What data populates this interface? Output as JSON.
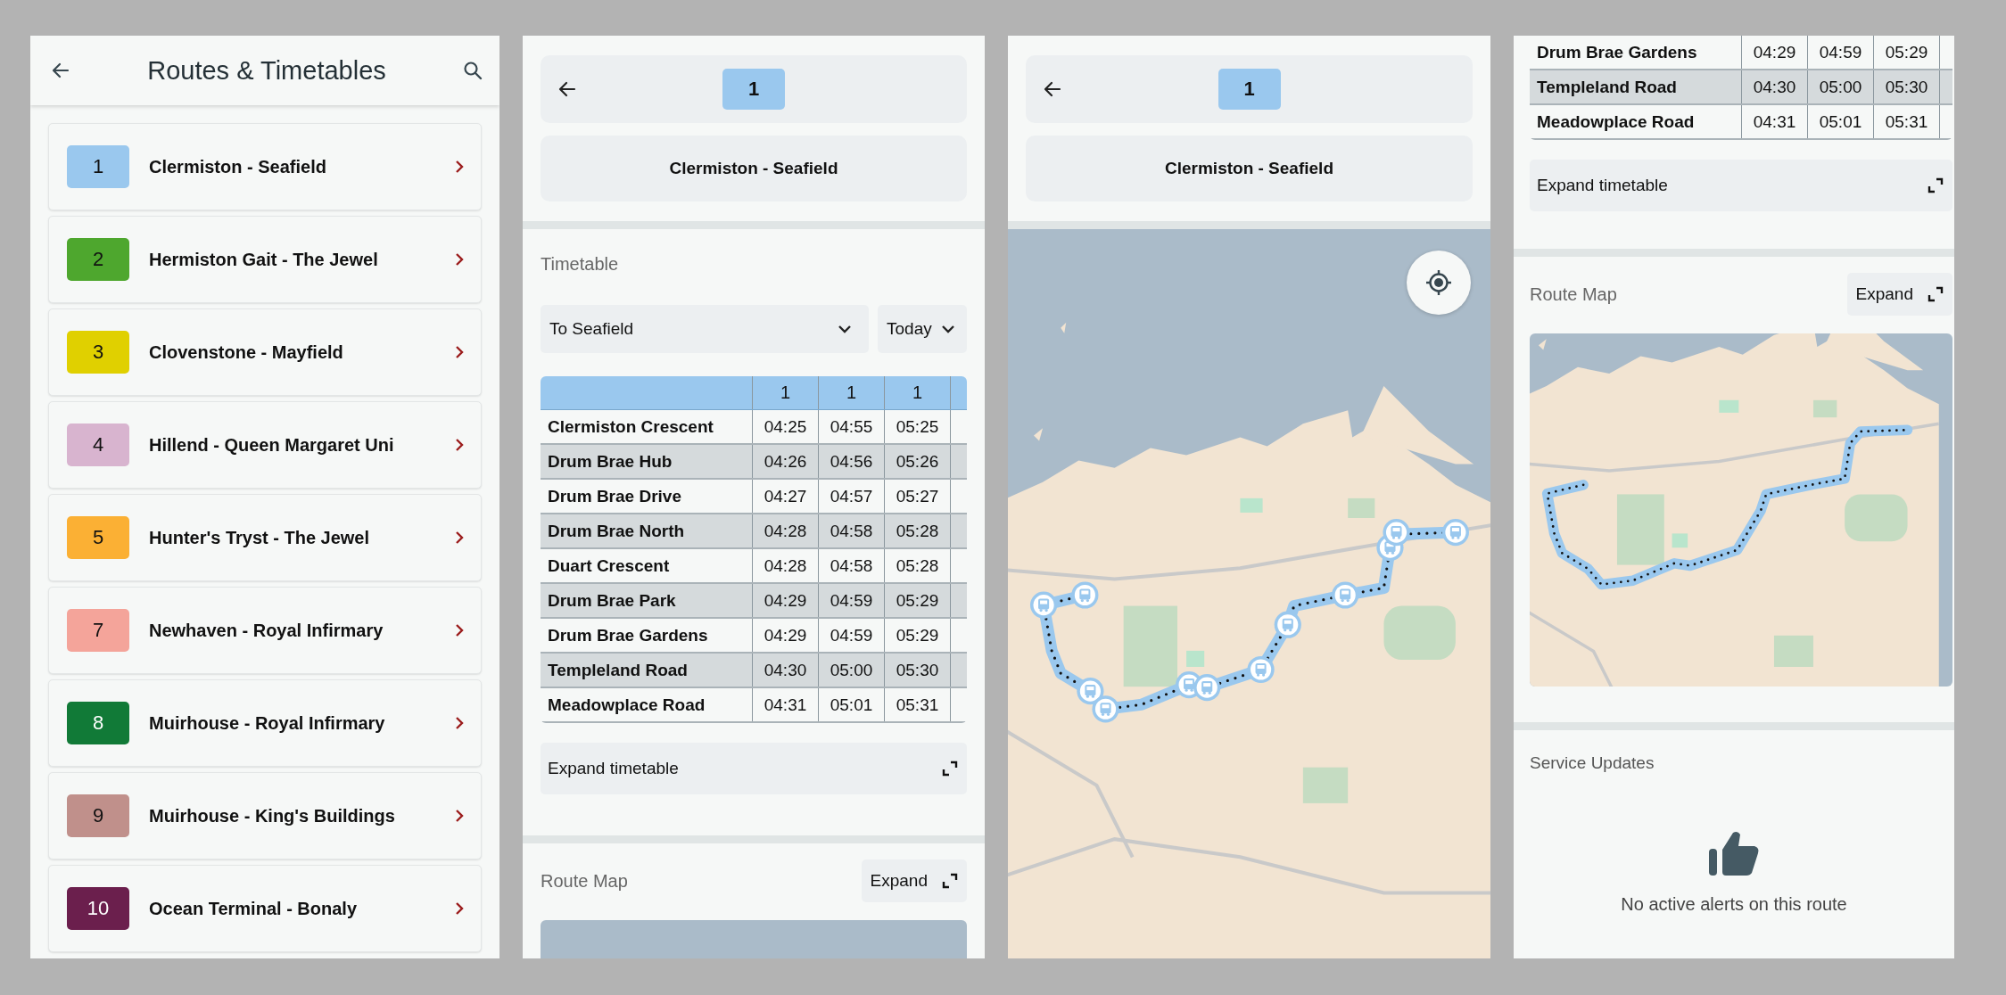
{
  "screens": [
    {
      "kind": "route_list",
      "header": {
        "title": "Routes & Timetables"
      },
      "routes": [
        {
          "number": "1",
          "name": "Clermiston - Seafield",
          "color": "#9ac8ee"
        },
        {
          "number": "2",
          "name": "Hermiston Gait - The Jewel",
          "color": "#4ea72e"
        },
        {
          "number": "3",
          "name": "Clovenstone - Mayfield",
          "color": "#e0d000"
        },
        {
          "number": "4",
          "name": "Hillend - Queen Margaret Uni",
          "color": "#d8b4cf"
        },
        {
          "number": "5",
          "name": "Hunter's Tryst - The Jewel",
          "color": "#fbb034"
        },
        {
          "number": "7",
          "name": "Newhaven - Royal Infirmary",
          "color": "#f4a49a"
        },
        {
          "number": "8",
          "name": "Muirhouse - Royal Infirmary",
          "color": "#117a37"
        },
        {
          "number": "9",
          "name": "Muirhouse - King's Buildings",
          "color": "#c0908b"
        },
        {
          "number": "10",
          "name": "Ocean Terminal - Bonaly",
          "color": "#6b1f4d"
        }
      ]
    },
    {
      "kind": "route_detail",
      "route": {
        "number": "1",
        "name": "Clermiston - Seafield",
        "color": "#9ac8ee"
      },
      "timetable": {
        "title": "Timetable",
        "direction": "To Seafield",
        "day": "Today",
        "columns": [
          "1",
          "1",
          "1"
        ],
        "rows": [
          {
            "stop": "Clermiston Crescent",
            "times": [
              "04:25",
              "04:55",
              "05:25"
            ]
          },
          {
            "stop": "Drum Brae Hub",
            "times": [
              "04:26",
              "04:56",
              "05:26"
            ]
          },
          {
            "stop": "Drum Brae Drive",
            "times": [
              "04:27",
              "04:57",
              "05:27"
            ]
          },
          {
            "stop": "Drum Brae North",
            "times": [
              "04:28",
              "04:58",
              "05:28"
            ]
          },
          {
            "stop": "Duart Crescent",
            "times": [
              "04:28",
              "04:58",
              "05:28"
            ]
          },
          {
            "stop": "Drum Brae Park",
            "times": [
              "04:29",
              "04:59",
              "05:29"
            ]
          },
          {
            "stop": "Drum Brae Gardens",
            "times": [
              "04:29",
              "04:59",
              "05:29"
            ]
          },
          {
            "stop": "Templeland Road",
            "times": [
              "04:30",
              "05:00",
              "05:30"
            ]
          },
          {
            "stop": "Meadowplace Road",
            "times": [
              "04:31",
              "05:01",
              "05:31"
            ]
          }
        ],
        "expand_label": "Expand timetable"
      },
      "route_map": {
        "title": "Route Map",
        "expand_label": "Expand"
      }
    },
    {
      "kind": "route_map_full",
      "route": {
        "number": "1",
        "name": "Clermiston - Seafield",
        "color": "#9ac8ee"
      }
    },
    {
      "kind": "route_detail_scrolled",
      "timetable": {
        "rows": [
          {
            "stop": "Drum Brae Gardens",
            "times": [
              "04:29",
              "04:59",
              "05:29"
            ]
          },
          {
            "stop": "Templeland Road",
            "times": [
              "04:30",
              "05:00",
              "05:30"
            ]
          },
          {
            "stop": "Meadowplace Road",
            "times": [
              "04:31",
              "05:01",
              "05:31"
            ]
          }
        ],
        "expand_label": "Expand timetable"
      },
      "route_map": {
        "title": "Route Map",
        "expand_label": "Expand"
      },
      "service_updates": {
        "title": "Service Updates",
        "message": "No active alerts on this route"
      }
    }
  ]
}
